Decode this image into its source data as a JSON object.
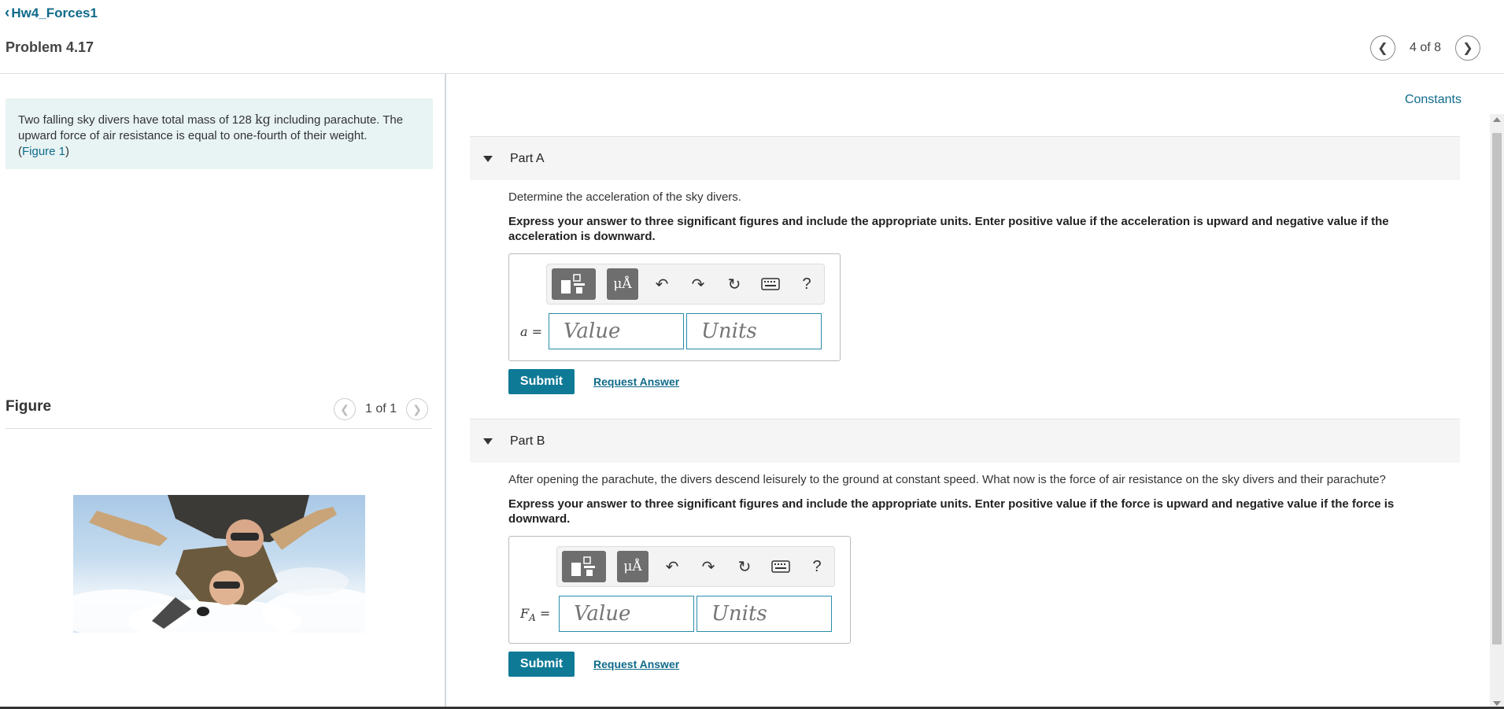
{
  "header": {
    "back_label": "Hw4_Forces1",
    "problem_title": "Problem 4.17",
    "pager_text": "4 of 8"
  },
  "problem": {
    "text_before_unit": "Two falling sky divers have total mass of 128 ",
    "unit": "kg",
    "text_after_unit": " including parachute. The upward force of air resistance is equal to one-fourth of their weight.",
    "figure_paren_open": "(",
    "figure_link": "Figure 1",
    "figure_paren_close": ")"
  },
  "figure": {
    "title": "Figure",
    "pager_text": "1 of 1"
  },
  "constants_label": "Constants",
  "parts": {
    "a": {
      "label": "Part A",
      "question": "Determine the acceleration of the sky divers.",
      "instruction": "Express your answer to three significant figures and include the appropriate units. Enter positive value if the acceleration is upward and negative value if the acceleration is downward.",
      "variable": "a",
      "equals": " =",
      "value_placeholder": "Value",
      "units_placeholder": "Units",
      "submit_label": "Submit",
      "request_label": "Request Answer"
    },
    "b": {
      "label": "Part B",
      "question": "After opening the parachute, the divers descend leisurely to the ground at constant speed. What now is the force of air resistance on the sky divers and their parachute?",
      "instruction": "Express your answer to three significant figures and include the appropriate units. Enter positive value if the force is upward and negative value if the force is downward.",
      "variable": "F",
      "subscript": "A",
      "equals": " =",
      "value_placeholder": "Value",
      "units_placeholder": "Units",
      "submit_label": "Submit",
      "request_label": "Request Answer"
    }
  },
  "toolbar": {
    "mu_label": "μÅ",
    "help_label": "?"
  },
  "icons": {
    "back": "chevron-left-icon",
    "prev": "chevron-left-icon",
    "next": "chevron-right-icon",
    "undo": "undo-icon",
    "redo": "redo-icon",
    "reset": "reset-icon",
    "keyboard": "keyboard-icon",
    "collapse": "caret-down-icon"
  },
  "colors": {
    "accent": "#0f7a96",
    "link": "#0f6a8a",
    "problem_bg": "#e8f4f4",
    "field_border": "#2a8caa"
  }
}
